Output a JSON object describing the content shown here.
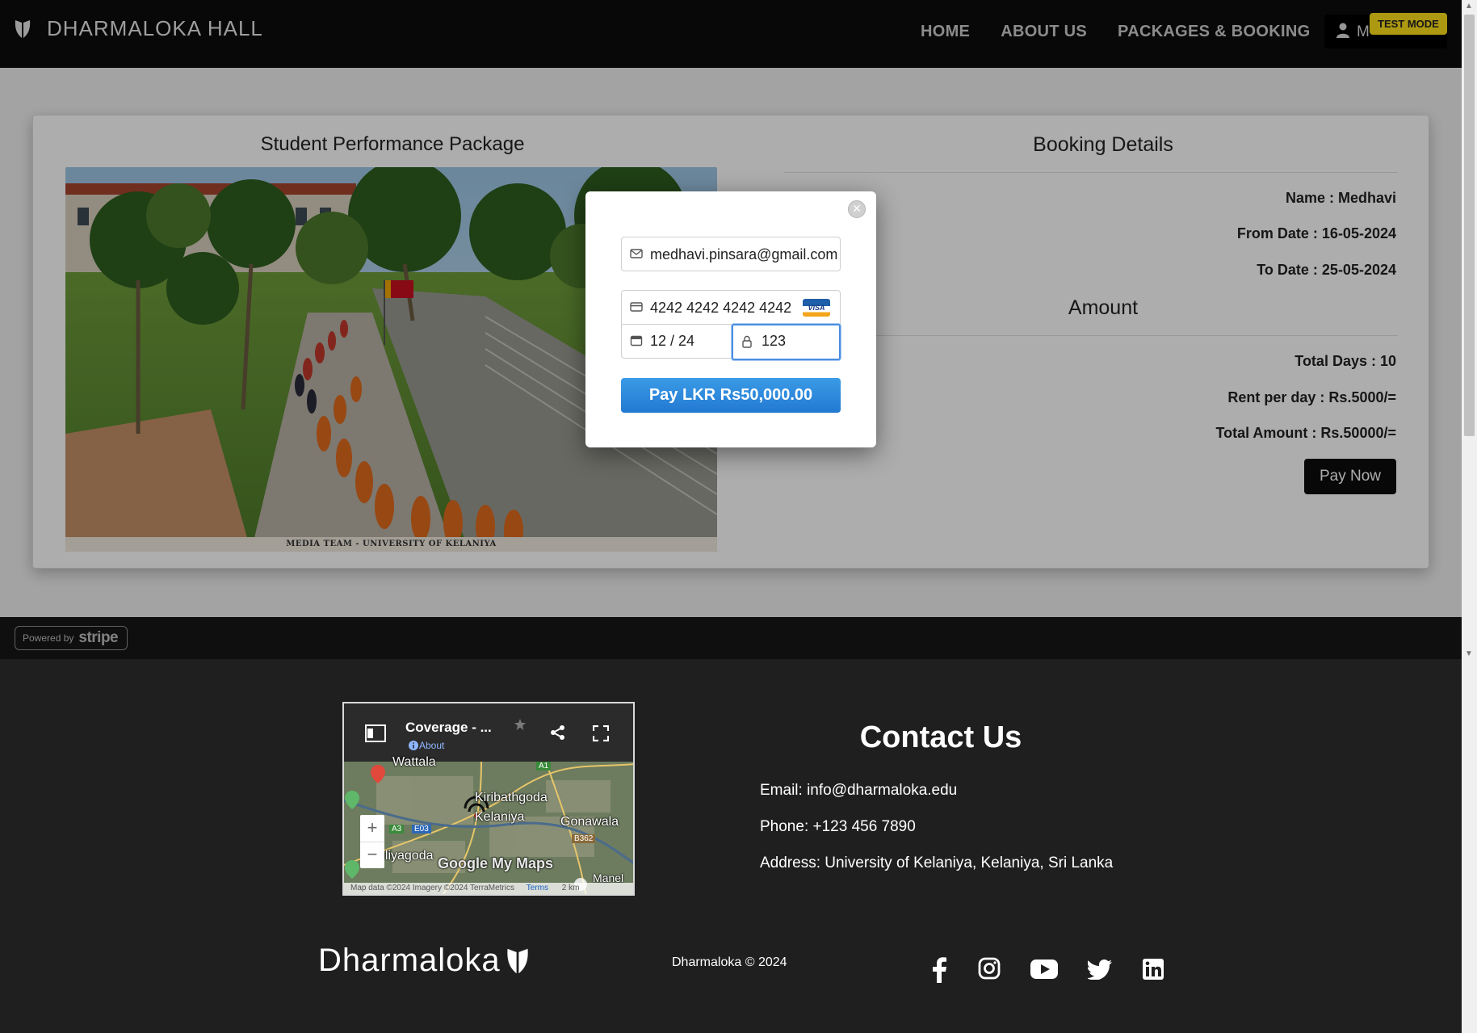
{
  "header": {
    "brand": "DHARMALOKA HALL",
    "nav": [
      "HOME",
      "ABOUT US",
      "PACKAGES & BOOKING"
    ],
    "user_label": "M",
    "test_mode": "TEST MODE"
  },
  "package": {
    "title": "Student Performance Package",
    "image_caption": "MEDIA TEAM - UNIVERSITY OF KELANIYA"
  },
  "booking": {
    "title": "Booking Details",
    "name": "Name : Medhavi",
    "from_date": "From Date : 16-05-2024",
    "to_date": "To Date : 25-05-2024",
    "amount_title": "Amount",
    "total_days": "Total Days : 10",
    "rent_per_day": "Rent per day : Rs.5000/=",
    "total_amount": "Total Amount : Rs.50000/=",
    "pay_now": "Pay Now"
  },
  "payment_modal": {
    "email": "medhavi.pinsara@gmail.com",
    "card_number": "4242 4242 4242 4242",
    "card_brand": "VISA",
    "expiry": "12 / 24",
    "cvc": "123",
    "pay_button": "Pay LKR Rs50,000.00"
  },
  "stripe": {
    "powered_by": "Powered by",
    "brand": "stripe"
  },
  "map": {
    "title": "Coverage - ...",
    "about": "About",
    "labels": [
      "Wattala",
      "Kelaniya",
      "Kiribathgoda",
      "Gonawala",
      "eliyagoda",
      "Manel"
    ],
    "road_labels": [
      "A1",
      "A3",
      "E03",
      "B362"
    ],
    "attribution": "Map data ©2024 Imagery ©2024 TerraMetrics",
    "terms": "Terms",
    "scale": "2 km",
    "google_logo": "Google My Maps"
  },
  "contact": {
    "title": "Contact Us",
    "email": "Email: info@dharmaloka.edu",
    "phone": "Phone: +123 456 7890",
    "address": "Address: University of Kelaniya, Kelaniya, Sri Lanka"
  },
  "footer": {
    "logo_text": "Dharmaloka",
    "copyright": "Dharmaloka © 2024",
    "social": [
      "facebook-icon",
      "instagram-icon",
      "youtube-icon",
      "twitter-icon",
      "linkedin-icon"
    ]
  },
  "colors": {
    "nav_bg": "#0d0d0d",
    "footer_bg": "#1f1f1f",
    "pay_button": "#2a85d9",
    "test_mode": "#ffe11a"
  }
}
